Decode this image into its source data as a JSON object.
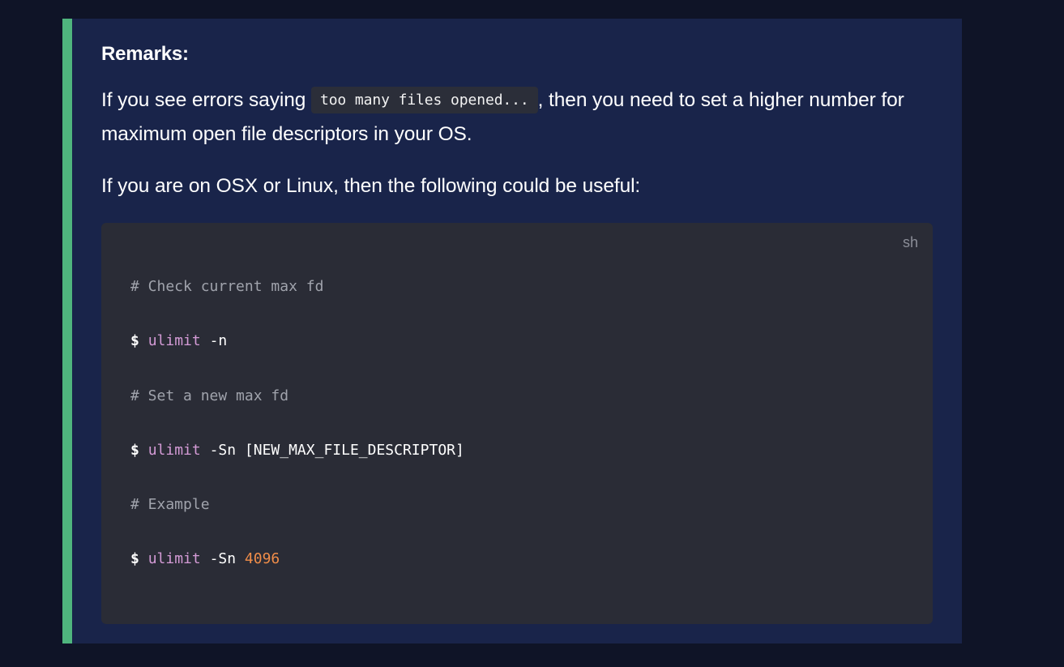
{
  "remarks": {
    "title": "Remarks:",
    "para1": {
      "before": "If you see errors saying ",
      "code": "too many files opened...",
      "after": ", then you need to set a higher number for maximum open file descriptors in your OS."
    },
    "para2": "If you are on OSX or Linux, then the following could be useful:"
  },
  "code_block": {
    "language": "sh",
    "lines": [
      {
        "comment": "# Check current max fd"
      },
      {
        "prompt": "$",
        "cmd": "ulimit",
        "arg": "-n"
      },
      {
        "comment": "# Set a new max fd"
      },
      {
        "prompt": "$",
        "cmd": "ulimit",
        "arg": "-Sn [NEW_MAX_FILE_DESCRIPTOR]"
      },
      {
        "comment": "# Example"
      },
      {
        "prompt": "$",
        "cmd": "ulimit",
        "arg": "-Sn",
        "num": "4096"
      }
    ]
  },
  "colors": {
    "page_bg": "#0f1427",
    "callout_bg": "#19244a",
    "callout_border": "#4fb57e",
    "code_bg": "#2a2c36",
    "comment": "#a0a3ac",
    "command": "#d49bd6",
    "number": "#f08d49"
  }
}
